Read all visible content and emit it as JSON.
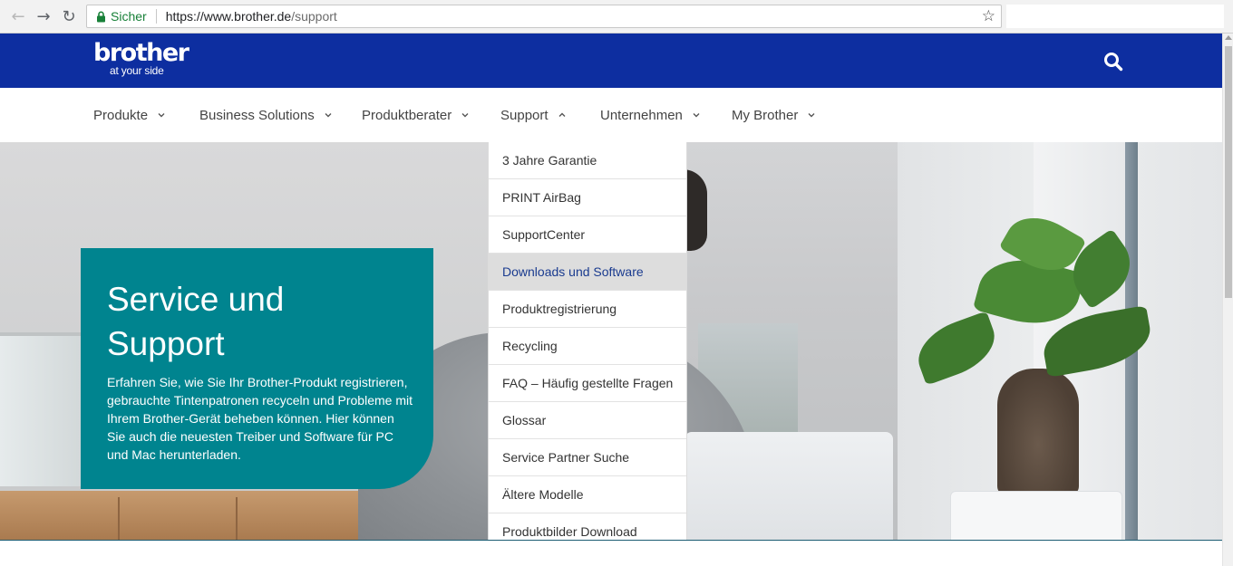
{
  "browser": {
    "secure_label": "Sicher",
    "url_host": "https://www.brother.de",
    "url_path": "/support",
    "icons": [
      "back-arrow-icon",
      "forward-arrow-icon",
      "reload-icon",
      "lock-icon",
      "bookmark-star-icon"
    ]
  },
  "header": {
    "logo_word": "brother",
    "logo_tagline": "at your side",
    "brand_color": "#0d2ea0",
    "search_icon": "search-icon"
  },
  "nav": {
    "items": [
      {
        "label": "Produkte",
        "chevron": "chevron-down-icon"
      },
      {
        "label": "Business Solutions",
        "chevron": "chevron-down-icon"
      },
      {
        "label": "Produktberater",
        "chevron": "chevron-down-icon"
      },
      {
        "label": "Support",
        "chevron": "chevron-up-icon"
      },
      {
        "label": "Unternehmen",
        "chevron": "chevron-down-icon"
      },
      {
        "label": "My Brother",
        "chevron": "chevron-down-icon"
      }
    ]
  },
  "support_menu": {
    "items": [
      {
        "label": "3 Jahre Garantie"
      },
      {
        "label": "PRINT AirBag"
      },
      {
        "label": "SupportCenter"
      },
      {
        "label": "Downloads und Software",
        "highlighted": true
      },
      {
        "label": "Produktregistrierung"
      },
      {
        "label": "Recycling"
      },
      {
        "label": "FAQ – Häufig gestellte Fragen"
      },
      {
        "label": "Glossar"
      },
      {
        "label": "Service Partner Suche"
      },
      {
        "label": "Ältere Modelle"
      },
      {
        "label": "Produktbilder Download"
      }
    ]
  },
  "hero": {
    "title_line1": "Service und",
    "title_line2": "Support",
    "description": "Erfahren Sie, wie Sie Ihr Brother-Produkt registrieren, gebrauchte Tintenpatronen recyceln und Probleme mit Ihrem Brother-Gerät beheben können. Hier können Sie auch die neuesten Treiber und Software für PC und Mac herunterladen.",
    "card_color": "#00848f"
  }
}
